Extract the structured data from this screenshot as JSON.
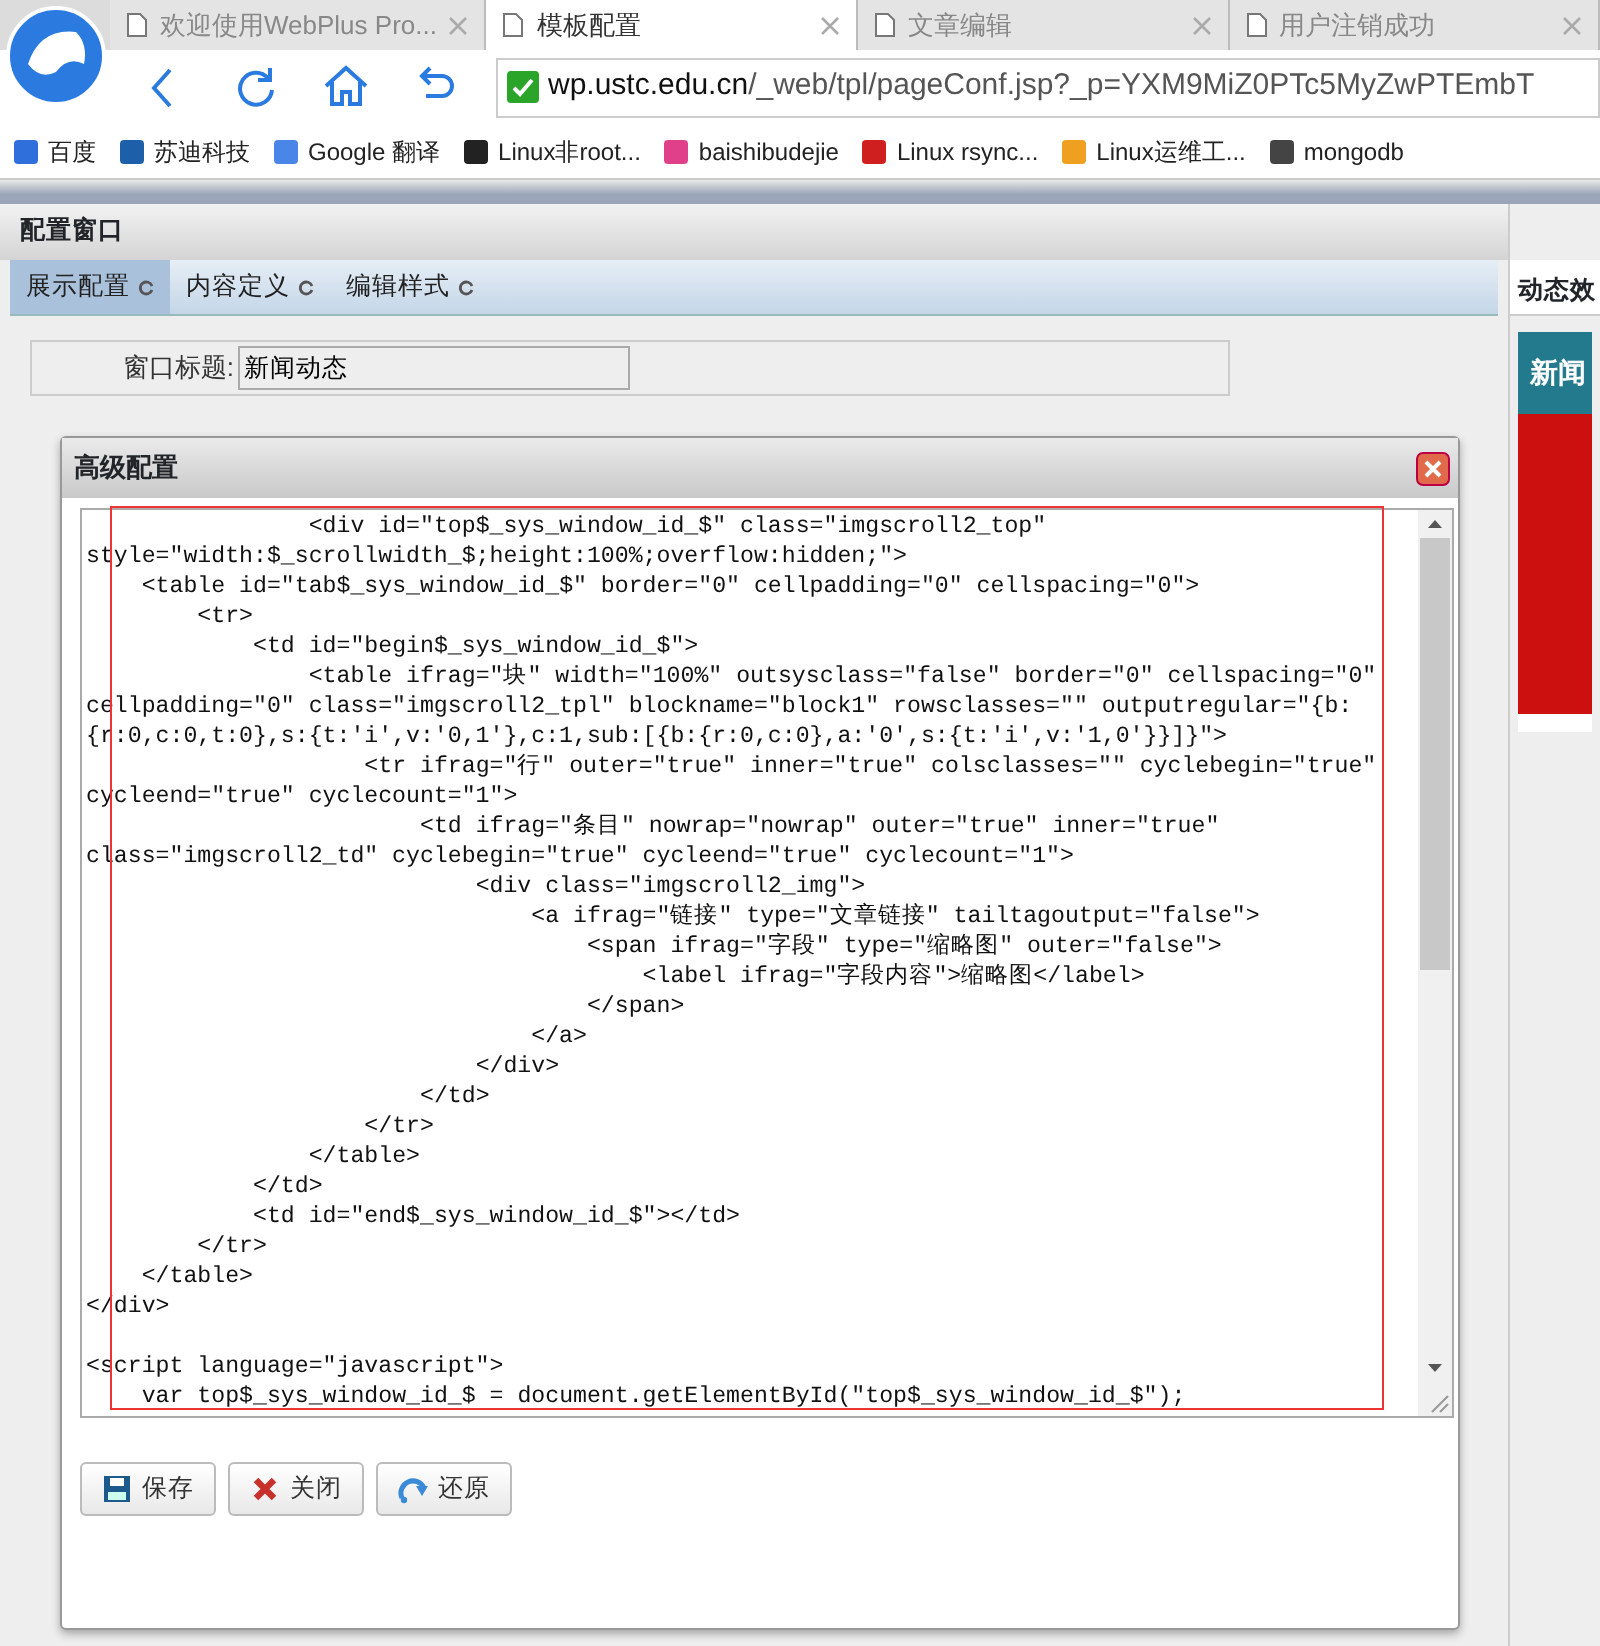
{
  "browser": {
    "tabs": [
      {
        "label": "欢迎使用WebPlus Pro...",
        "selected": false
      },
      {
        "label": "模板配置",
        "selected": true
      },
      {
        "label": "文章编辑",
        "selected": false
      },
      {
        "label": "用户注销成功",
        "selected": false
      }
    ],
    "address": {
      "secure": true,
      "host": "wp.ustc.edu.cn",
      "path": "/_web/tpl/pageConf.jsp?_p=YXM9MiZ0PTc5MyZwPTEmbT"
    },
    "bookmarks": [
      {
        "label": "百度",
        "color": "#2f6fdc"
      },
      {
        "label": "苏迪科技",
        "color": "#1d5fa8"
      },
      {
        "label": "Google 翻译",
        "color": "#4a86e8"
      },
      {
        "label": "Linux非root...",
        "color": "#222222"
      },
      {
        "label": "baishibudejie",
        "color": "#e0408a"
      },
      {
        "label": "Linux rsync...",
        "color": "#d01f1f"
      },
      {
        "label": "Linux运维工...",
        "color": "#f0a020"
      },
      {
        "label": "mongodb",
        "color": "#444444"
      }
    ]
  },
  "page": {
    "title": "配置窗口",
    "tabs": [
      {
        "label": "展示配置",
        "selected": true
      },
      {
        "label": "内容定义",
        "selected": false
      },
      {
        "label": "编辑样式",
        "selected": false
      }
    ],
    "form": {
      "label": "窗口标题:",
      "value": "新闻动态"
    },
    "preview": {
      "title": "动态效",
      "card_title": "新闻"
    }
  },
  "dialog": {
    "title": "高级配置",
    "code_blocks": [
      {
        "lines": [
          "                <div id=\"top$_sys_window_id_$\" class=\"imgscroll2_top\" style=\"width:$_scrollwidth_$;height:100%;overflow:hidden;\">",
          "    <table id=\"tab$_sys_window_id_$\" border=\"0\" cellpadding=\"0\" cellspacing=\"0\">",
          "        <tr>",
          "            <td id=\"begin$_sys_window_id_$\">",
          "                <table ifrag=\"块\" width=\"100%\" outsysclass=\"false\" border=\"0\" cellspacing=\"0\" cellpadding=\"0\" class=\"imgscroll2_tpl\" blockname=\"block1\" rowsclasses=\"\" outputregular=\"{b:{r:0,c:0,t:0},s:{t:'i',v:'0,1'},c:1,sub:[{b:{r:0,c:0},a:'0',s:{t:'i',v:'1,0'}}]}\">",
          "                    <tr ifrag=\"行\" outer=\"true\" inner=\"true\" colsclasses=\"\" cyclebegin=\"true\" cycleend=\"true\" cyclecount=\"1\">",
          "                        <td ifrag=\"条目\" nowrap=\"nowrap\" outer=\"true\" inner=\"true\" class=\"imgscroll2_td\" cyclebegin=\"true\" cycleend=\"true\" cyclecount=\"1\">",
          "                            <div class=\"imgscroll2_img\">",
          "                                <a ifrag=\"链接\" type=\"文章链接\" tailtagoutput=\"false\">",
          "                                    <span ifrag=\"字段\" type=\"缩略图\" outer=\"false\">",
          "                                        <label ifrag=\"字段内容\">缩略图</label>",
          "                                    </span>",
          "                                </a>",
          "                            </div>",
          "                        </td>",
          "                    </tr>",
          "                </table>",
          "            </td>",
          "            <td id=\"end$_sys_window_id_$\"></td>",
          "        </tr>",
          "    </table>",
          "</div>"
        ]
      },
      {
        "lines": [
          "<script language=\"javascript\">",
          "    var top$_sys_window_id_$ = document.getElementById(\"top$_sys_window_id_$\");"
        ]
      }
    ],
    "buttons": [
      {
        "label": "保存",
        "kind": "save"
      },
      {
        "label": "关闭",
        "kind": "close"
      },
      {
        "label": "还原",
        "kind": "restore"
      }
    ]
  }
}
